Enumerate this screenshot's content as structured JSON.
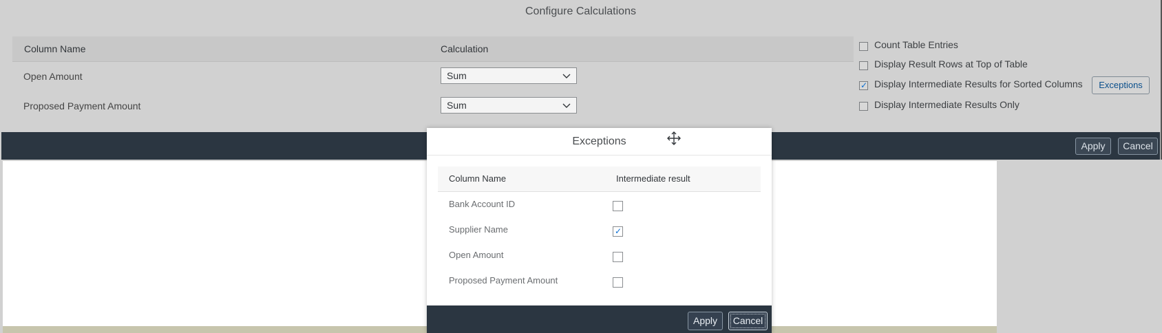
{
  "calc_dialog": {
    "title": "Configure Calculations",
    "table": {
      "headers": {
        "column_name": "Column Name",
        "calculation": "Calculation"
      },
      "rows": [
        {
          "label": "Open Amount",
          "calculation": "Sum"
        },
        {
          "label": "Proposed Payment Amount",
          "calculation": "Sum"
        }
      ]
    },
    "options": [
      {
        "label": "Count Table Entries",
        "checked": false
      },
      {
        "label": "Display Result Rows at Top of Table",
        "checked": false
      },
      {
        "label": "Display Intermediate Results for Sorted Columns",
        "checked": true
      },
      {
        "label": "Display Intermediate Results Only",
        "checked": false
      }
    ],
    "exceptions_button": "Exceptions",
    "footer": {
      "apply": "Apply",
      "cancel": "Cancel"
    }
  },
  "exceptions_dialog": {
    "title": "Exceptions",
    "headers": {
      "column_name": "Column Name",
      "intermediate_result": "Intermediate result"
    },
    "rows": [
      {
        "label": "Bank Account ID",
        "checked": false
      },
      {
        "label": "Supplier Name",
        "checked": true
      },
      {
        "label": "Open Amount",
        "checked": false
      },
      {
        "label": "Proposed Payment Amount",
        "checked": false
      }
    ],
    "footer": {
      "apply": "Apply",
      "cancel": "Cancel"
    }
  },
  "icons": {
    "dropdown": "chevron-down-icon",
    "drag": "move-icon",
    "checkmark": "checkmark-icon"
  },
  "colors": {
    "footer_bar": "#2b3641",
    "accent": "#0a6ed1"
  }
}
